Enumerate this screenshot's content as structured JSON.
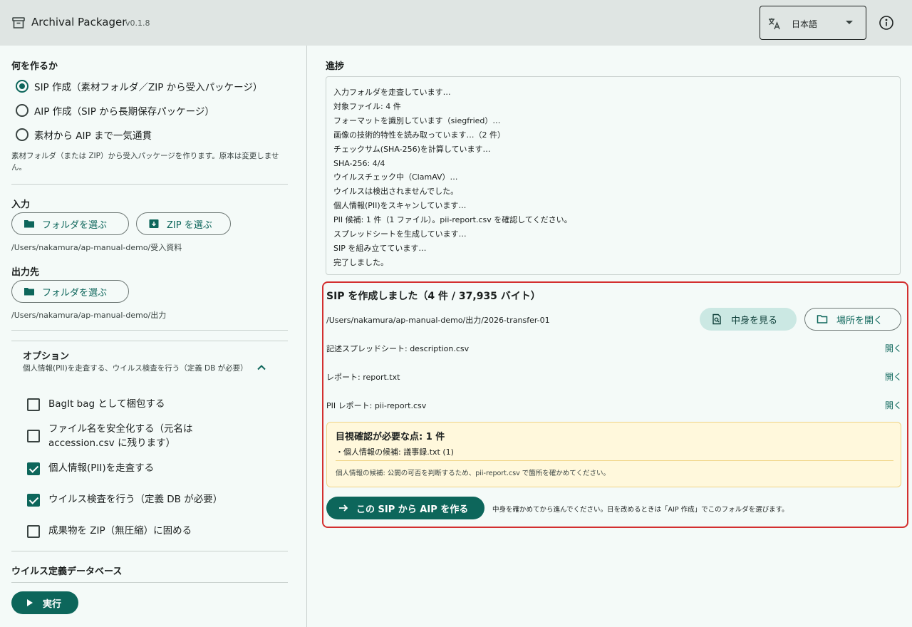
{
  "header": {
    "title": "Archival Packager",
    "version": "v0.1.8",
    "language": "日本語"
  },
  "left": {
    "mode_title": "何を作るか",
    "modes": [
      {
        "label": "SIP 作成（素材フォルダ／ZIP から受入パッケージ）",
        "selected": true
      },
      {
        "label": "AIP 作成（SIP から長期保存パッケージ）",
        "selected": false
      },
      {
        "label": "素材から AIP まで一気通貫",
        "selected": false
      }
    ],
    "mode_hint": "素材フォルダ（または ZIP）から受入パッケージを作ります。原本は変更しません。",
    "input_title": "入力",
    "choose_folder": "フォルダを選ぶ",
    "choose_zip": "ZIP を選ぶ",
    "input_path": "/Users/nakamura/ap-manual-demo/受入資料",
    "output_title": "出力先",
    "output_choose_folder": "フォルダを選ぶ",
    "output_path": "/Users/nakamura/ap-manual-demo/出力",
    "options": {
      "title": "オプション",
      "summary": "個人情報(PII)を走査する、ウイルス検査を行う（定義 DB が必要）",
      "items": [
        {
          "label": "BagIt bag として梱包する",
          "checked": false
        },
        {
          "label": "ファイル名を安全化する（元名は accession.csv に残ります）",
          "checked": false
        },
        {
          "label": "個人情報(PII)を走査する",
          "checked": true
        },
        {
          "label": "ウイルス検査を行う（定義 DB が必要）",
          "checked": true
        },
        {
          "label": "成果物を ZIP（無圧縮）に固める",
          "checked": false
        }
      ]
    },
    "virus_db_title": "ウイルス定義データベース",
    "run_label": "実行"
  },
  "right": {
    "progress_title": "進捗",
    "log": [
      "入力フォルダを走査しています…",
      "対象ファイル: 4 件",
      "フォーマットを識別しています（siegfried）…",
      "画像の技術的特性を読み取っています…（2 件）",
      "チェックサム(SHA-256)を計算しています…",
      "SHA-256: 4/4",
      "ウイルスチェック中（ClamAV）…",
      "ウイルスは検出されませんでした。",
      "個人情報(PII)をスキャンしています…",
      "PII 候補: 1 件（1 ファイル）。pii-report.csv を確認してください。",
      "スプレッドシートを生成しています…",
      "SIP を組み立てています…",
      "完了しました。"
    ],
    "result": {
      "title": "SIP を作成しました（4 件 / 37,935 バイト）",
      "path": "/Users/nakamura/ap-manual-demo/出力/2026-transfer-01",
      "view_contents": "中身を見る",
      "open_location": "場所を開く",
      "files": [
        {
          "label": "記述スプレッドシート: description.csv",
          "action": "開く"
        },
        {
          "label": "レポート: report.txt",
          "action": "開く"
        },
        {
          "label": "PII レポート: pii-report.csv",
          "action": "開く"
        }
      ],
      "review": {
        "title": "目視確認が必要な点: 1 件",
        "item": "・個人情報の候補: 議事録.txt (1)",
        "note": "個人情報の候補: 公開の可否を判断するため、pii-report.csv で箇所を確かめてください。"
      },
      "make_aip": "この SIP から AIP を作る",
      "next_note": "中身を確かめてから進んでください。日を改めるときは「AIP 作成」でこのフォルダを選びます。"
    }
  },
  "colors": {
    "accent": "#0d665b",
    "highlight_border": "#d32f2f",
    "warn_bg": "#fff8dc"
  }
}
